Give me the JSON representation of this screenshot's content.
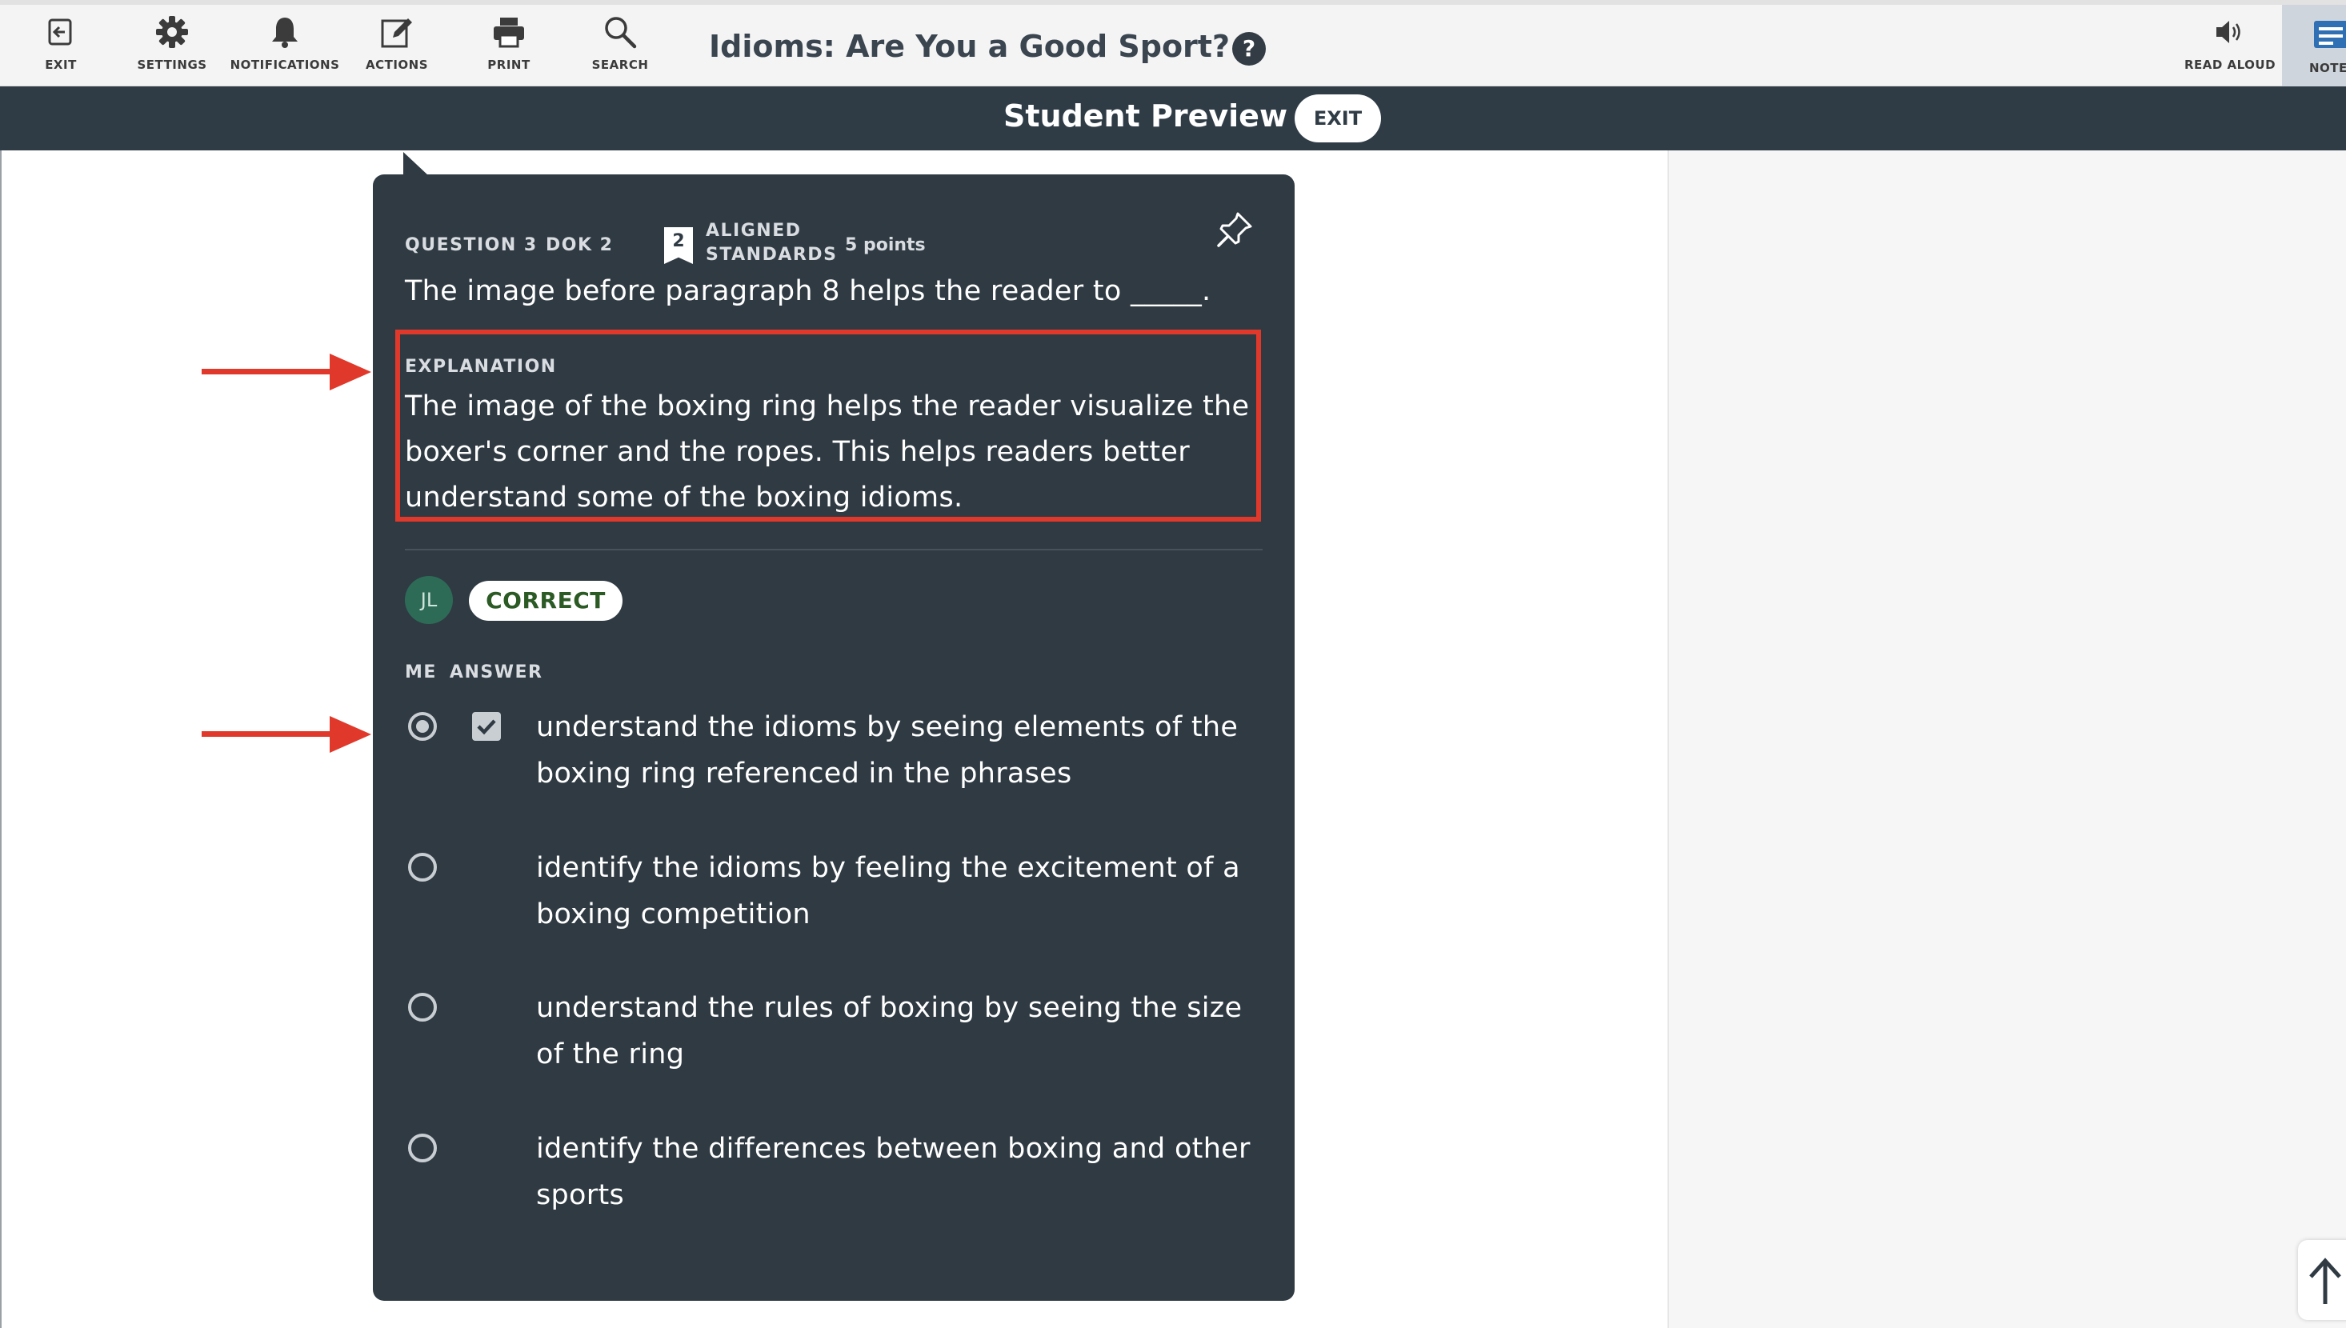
{
  "toolbar": {
    "items": [
      {
        "label": "EXIT",
        "icon": "exit-icon"
      },
      {
        "label": "SETTINGS",
        "icon": "gear-icon"
      },
      {
        "label": "NOTIFICATIONS",
        "icon": "bell-icon"
      },
      {
        "label": "ACTIONS",
        "icon": "edit-icon"
      },
      {
        "label": "PRINT",
        "icon": "printer-icon"
      },
      {
        "label": "SEARCH",
        "icon": "search-icon"
      }
    ],
    "title": "Idioms: Are You a Good Sport?",
    "help": "?",
    "read_aloud": {
      "label": "READ ALOUD",
      "icon": "speaker-icon"
    },
    "notes": {
      "label": "NOTE",
      "icon": "notes-icon"
    }
  },
  "preview_bar": {
    "title": "Student Preview",
    "exit_label": "EXIT"
  },
  "question": {
    "number": "QUESTION 3",
    "dok": "DOK 2",
    "standards_count": "2",
    "standards_label_line1": "ALIGNED",
    "standards_label_line2": "STANDARDS",
    "points": "5 points",
    "prompt": "The image before paragraph 8 helps the reader to _____.",
    "explanation_label": "EXPLANATION",
    "explanation": "The image of the boxing ring helps the reader visualize the boxer's corner and the ropes. This helps readers better understand some of the boxing idioms.",
    "student_initials": "JL",
    "result": "CORRECT",
    "col_me": "ME",
    "col_answer": "ANSWER",
    "options": [
      {
        "text": "understand the idioms by seeing elements of the boxing ring referenced in the phrases",
        "selected": true,
        "is_answer": true
      },
      {
        "text": "identify the idioms by feeling the excitement of a boxing competition",
        "selected": false,
        "is_answer": false
      },
      {
        "text": "understand the rules of boxing by seeing the size of the ring",
        "selected": false,
        "is_answer": false
      },
      {
        "text": "identify the differences between boxing and other sports",
        "selected": false,
        "is_answer": false
      }
    ]
  },
  "colors": {
    "card_bg": "#2f3a43",
    "preview_bar_bg": "#2f3c46",
    "highlight_red": "#e0392b",
    "correct_green": "#2b5a24",
    "avatar_green": "#2e6b57"
  }
}
